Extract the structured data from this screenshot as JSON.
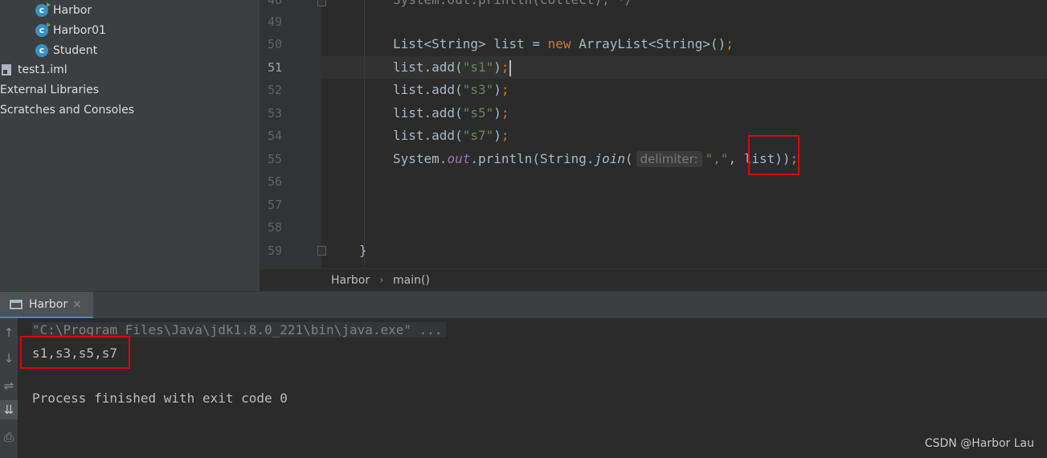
{
  "project_tree": {
    "items": [
      {
        "label": "Harbor",
        "icon": "java-class-runnable-icon"
      },
      {
        "label": "Harbor01",
        "icon": "java-class-runnable-icon"
      },
      {
        "label": "Student",
        "icon": "java-class-icon"
      },
      {
        "label": "test1.iml",
        "icon": "iml-file-icon"
      },
      {
        "label": "External Libraries",
        "icon": ""
      },
      {
        "label": "Scratches and Consoles",
        "icon": ""
      }
    ],
    "class_icon_letter": "c"
  },
  "editor": {
    "line_numbers": [
      "49",
      "50",
      "51",
      "52",
      "53",
      "54",
      "55",
      "56",
      "57",
      "58",
      "59"
    ],
    "current_line": "51",
    "top_partial_line": "System.out.println(collect); */",
    "code": {
      "line50": {
        "type": "List<String>",
        "var": " list = ",
        "kw_new": "new",
        "ctor": " ArrayList<String>()",
        "end": ";"
      },
      "line51": {
        "call": "list.add(",
        "arg": "\"s1\"",
        "close": ")",
        "end": ";"
      },
      "line52": {
        "call": "list.add(",
        "arg": "\"s3\"",
        "close": ")",
        "end": ";"
      },
      "line53": {
        "call": "list.add(",
        "arg": "\"s5\"",
        "close": ")",
        "end": ";"
      },
      "line54": {
        "call": "list.add(",
        "arg": "\"s7\"",
        "close": ")",
        "end": ";"
      },
      "line55": {
        "sys": "System.",
        "out": "out",
        "println": ".println(String.",
        "join": "join",
        "paren": "(",
        "hint": "delimiter:",
        "arg": "\",\"",
        "rest": ", list",
        "close": "))",
        "end": ";"
      },
      "line59": "}"
    }
  },
  "breadcrumb": {
    "items": [
      "Harbor",
      "main()"
    ],
    "separator": "›"
  },
  "run_window": {
    "tab_label": "Harbor",
    "tab_close": "×",
    "toolbar_icons": [
      "↑",
      "↓",
      "⇌",
      "⇊",
      "⎙"
    ],
    "console": {
      "command": "\"C:\\Program Files\\Java\\jdk1.8.0_221\\bin\\java.exe\" ...",
      "output": "s1,s3,s5,s7",
      "exit": "Process finished with exit code 0"
    }
  },
  "watermark": "CSDN @Harbor Lau",
  "colors": {
    "keyword": "#cc7832",
    "string": "#6a8759",
    "field": "#9876aa",
    "highlight_box": "#e3000b"
  }
}
